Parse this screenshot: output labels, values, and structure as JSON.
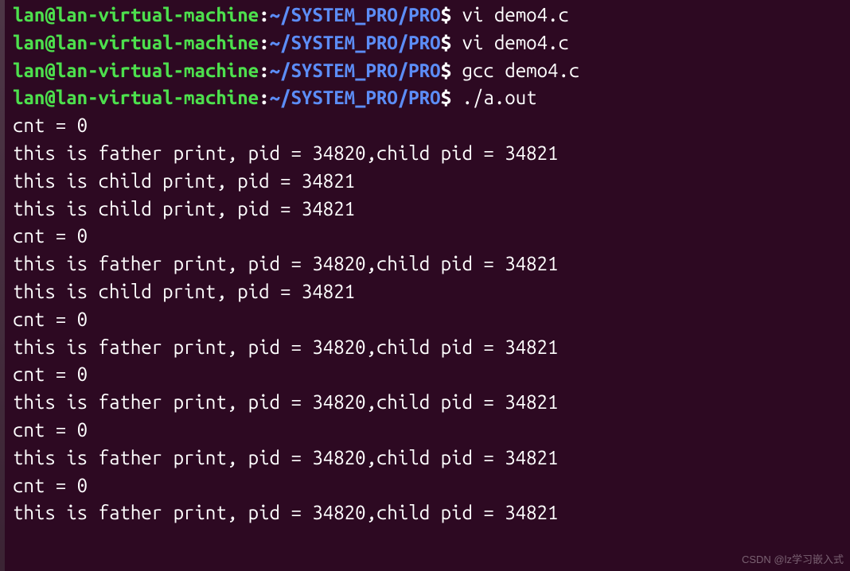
{
  "prompt": {
    "user": "lan@lan-virtual-machine",
    "colon": ":",
    "path": "~/SYSTEM_PRO/PRO",
    "dollar": "$"
  },
  "commands": [
    "vi demo4.c",
    "vi demo4.c",
    "gcc demo4.c",
    "./a.out"
  ],
  "output_lines": [
    "cnt = 0",
    "this is father print, pid = 34820,child pid = 34821",
    "this is child print, pid = 34821",
    "this is child print, pid = 34821",
    "cnt = 0",
    "this is father print, pid = 34820,child pid = 34821",
    "this is child print, pid = 34821",
    "cnt = 0",
    "this is father print, pid = 34820,child pid = 34821",
    "cnt = 0",
    "this is father print, pid = 34820,child pid = 34821",
    "cnt = 0",
    "this is father print, pid = 34820,child pid = 34821",
    "cnt = 0",
    "this is father print, pid = 34820,child pid = 34821"
  ],
  "watermark": "CSDN @lz学习嵌入式"
}
